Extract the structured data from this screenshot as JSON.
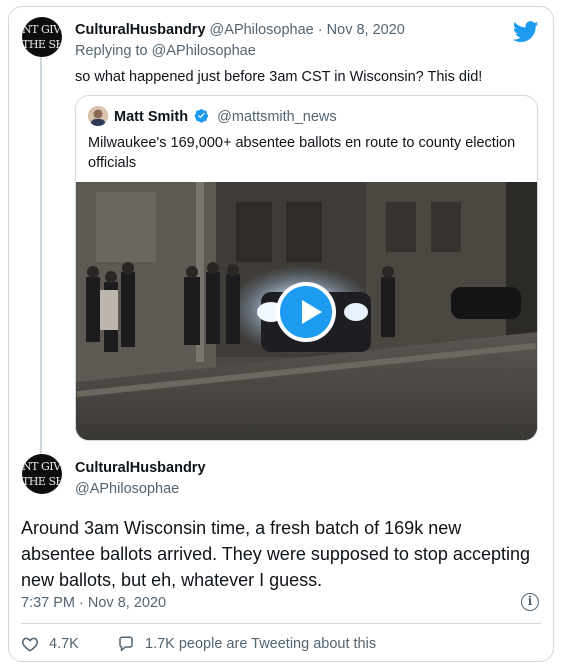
{
  "tweet1": {
    "author_name": "CulturalHusbandry",
    "author_handle": "@APhilosophae",
    "separator": "·",
    "date": "Nov 8, 2020",
    "replying_prefix": "Replying to",
    "replying_to": "@APhilosophae",
    "text": "so what happened just before 3am CST in Wisconsin? This did!",
    "avatar_lines": [
      "NT GIVE",
      "THE SHI"
    ]
  },
  "quote": {
    "author_name": "Matt Smith",
    "author_handle": "@mattsmith_news",
    "text": "Milwaukee's 169,000+ absentee ballots en route to county election officials"
  },
  "tweet2": {
    "author_name": "CulturalHusbandry",
    "author_handle": "@APhilosophae",
    "text": "Around 3am Wisconsin time, a fresh batch of 169k new absentee ballots arrived. They were supposed to stop accepting new ballots, but eh, whatever I guess.",
    "timestamp": "7:37 PM · Nov 8, 2020",
    "likes": "4.7K",
    "conversation": "1.7K people are Tweeting about this",
    "avatar_lines": [
      "NT GIVE",
      "THE SHI"
    ]
  },
  "colors": {
    "accent": "#1d9bf0",
    "text": "#0f1419",
    "muted": "#536471",
    "border": "#cfd9de"
  },
  "icons": [
    "twitter-bird-icon",
    "verified-badge-icon",
    "play-icon",
    "info-icon",
    "heart-icon",
    "conversation-icon"
  ]
}
